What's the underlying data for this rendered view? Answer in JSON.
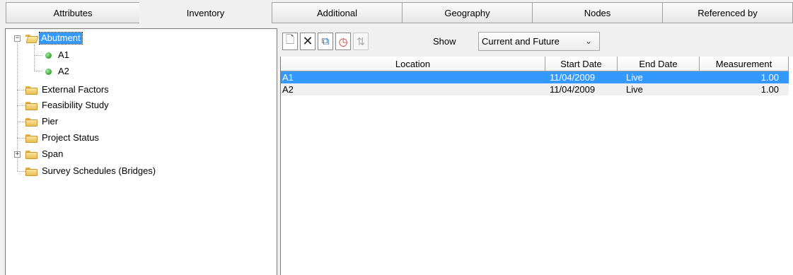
{
  "left_tabs": [
    {
      "label": "Attributes",
      "active": false
    },
    {
      "label": "Inventory",
      "active": true
    }
  ],
  "right_tabs": [
    {
      "label": "Additional"
    },
    {
      "label": "Geography"
    },
    {
      "label": "Nodes"
    },
    {
      "label": "Referenced by"
    }
  ],
  "tree": {
    "items": [
      {
        "label": "Abutment",
        "type": "folder-open",
        "expander": "−",
        "selected": true
      },
      {
        "label": "A1",
        "type": "node"
      },
      {
        "label": "A2",
        "type": "node"
      },
      {
        "label": "External Factors",
        "type": "folder"
      },
      {
        "label": "Feasibility Study",
        "type": "folder"
      },
      {
        "label": "Pier",
        "type": "folder"
      },
      {
        "label": "Project Status",
        "type": "folder"
      },
      {
        "label": "Span",
        "type": "folder",
        "expander": "+"
      },
      {
        "label": "Survey Schedules (Bridges)",
        "type": "folder"
      }
    ]
  },
  "toolbar": {
    "buttons": [
      {
        "icon": "new-document-icon",
        "glyph": "🗋"
      },
      {
        "icon": "delete-icon",
        "glyph": "✕"
      },
      {
        "icon": "copy-icon",
        "glyph": "⧉"
      },
      {
        "icon": "history-clock-icon",
        "glyph": "◷"
      },
      {
        "icon": "sort-icon",
        "glyph": "⇅"
      }
    ],
    "show_label": "Show",
    "show_value": "Current and Future"
  },
  "grid": {
    "columns": [
      "Location",
      "Start Date",
      "End Date",
      "Measurement"
    ],
    "rows": [
      {
        "location": "A1",
        "start": "11/04/2009",
        "end": "Live",
        "measurement": "1.00",
        "selected": true
      },
      {
        "location": "A2",
        "start": "11/04/2009",
        "end": "Live",
        "measurement": "1.00",
        "selected": false
      }
    ]
  },
  "colors": {
    "selection": "#3399ff",
    "node_dot": "#3fae3f",
    "folder": "#e7bf55"
  }
}
